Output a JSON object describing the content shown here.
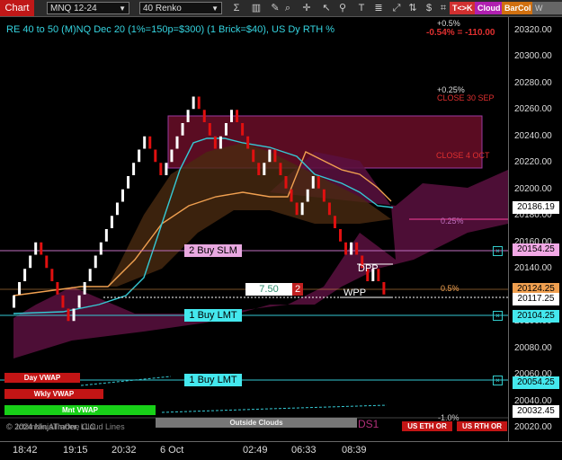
{
  "toolbar": {
    "chart_label": "Chart",
    "instrument": "MNQ 12-24",
    "bar_type": "40 Renko",
    "tck_label": "T<>K",
    "cloud_label": "Cloud",
    "barcol_label": "BarCol",
    "wvwa_label": "W VWA",
    "icons": [
      "sigma-icon",
      "chart-bars-icon",
      "draw-icon",
      "magnify-icon",
      "crosshair-icon",
      "cursor-icon",
      "pin-icon",
      "text-icon",
      "notes-icon",
      "fit-icon",
      "up-down-icon",
      "dollar-icon",
      "screenshot-icon",
      "table-icon"
    ]
  },
  "chart": {
    "title": "RE 40 to 50 (M)NQ Dec 20 (1%=150p=$300) (1 Brick=$40), US Dy RTH %",
    "pct_top": "+0.5%",
    "pct_change": "-0.54% = -110.00",
    "pct_025": "+0.25%",
    "close_30sep": "CLOSE 30 SEP",
    "close_4oct": "CLOSE 4 OCT",
    "line_025": "0.25%",
    "line_05": "0.5%",
    "line_neg1": "-1.0%",
    "dpp": "DPP",
    "wpp": "WPP",
    "ds1": "DS1",
    "outside_clouds": "Outside Clouds",
    "order_qty": "7.50",
    "order_count": "2",
    "buy_slm": "2 Buy SLM",
    "buy_lmt_1": "1 Buy LMT",
    "buy_lmt_2": "1 Buy LMT",
    "day_vwap": "Day VWAP",
    "wkly_vwap": "Wkly VWAP",
    "mnt_vwap": "Mnt VWAP",
    "copyright": "© 2024 NinjaTrader, LLC",
    "ichimoku_label": "IchimokuAllInOne Cloud Lines",
    "us_eth_or": "US ETH OR",
    "us_rth_or": "US RTH OR"
  },
  "price_axis": {
    "labels": [
      "20320.00",
      "20300.00",
      "20280.00",
      "20260.00",
      "20240.00",
      "20220.00",
      "20200.00",
      "20180.00",
      "20160.00",
      "20140.00",
      "20120.00",
      "20100.00",
      "20080.00",
      "20060.00",
      "20040.00",
      "20020.00"
    ],
    "tags": [
      {
        "value": "20186.19",
        "color": "#ffffff"
      },
      {
        "value": "20154.25",
        "color": "#f2a8e6"
      },
      {
        "value": "20124.25",
        "color": "#f0a050"
      },
      {
        "value": "20117.25",
        "color": "#ffffff"
      },
      {
        "value": "20104.25",
        "color": "#44e8ee"
      },
      {
        "value": "20054.25",
        "color": "#44e8ee"
      },
      {
        "value": "20032.45",
        "color": "#ffffff"
      }
    ]
  },
  "time_axis": [
    "18:42",
    "19:15",
    "20:32",
    "6 Oct",
    "02:49",
    "06:33",
    "08:39"
  ],
  "colors": {
    "up": "#ffffff",
    "down": "#e01010",
    "teal": "#35c9d4",
    "orange": "#f0a050",
    "magenta": "#c0307a"
  },
  "chart_data": {
    "type": "renko",
    "brick_size": 10,
    "bricks": [
      {
        "o": 20110,
        "c": 20120
      },
      {
        "o": 20120,
        "c": 20130
      },
      {
        "o": 20130,
        "c": 20140
      },
      {
        "o": 20140,
        "c": 20150
      },
      {
        "o": 20150,
        "c": 20160
      },
      {
        "o": 20160,
        "c": 20150
      },
      {
        "o": 20150,
        "c": 20140
      },
      {
        "o": 20140,
        "c": 20130
      },
      {
        "o": 20130,
        "c": 20120
      },
      {
        "o": 20120,
        "c": 20110
      },
      {
        "o": 20110,
        "c": 20100
      },
      {
        "o": 20100,
        "c": 20110
      },
      {
        "o": 20110,
        "c": 20120
      },
      {
        "o": 20120,
        "c": 20130
      },
      {
        "o": 20130,
        "c": 20140
      },
      {
        "o": 20140,
        "c": 20150
      },
      {
        "o": 20150,
        "c": 20160
      },
      {
        "o": 20160,
        "c": 20170
      },
      {
        "o": 20170,
        "c": 20180
      },
      {
        "o": 20180,
        "c": 20190
      },
      {
        "o": 20190,
        "c": 20200
      },
      {
        "o": 20200,
        "c": 20210
      },
      {
        "o": 20210,
        "c": 20220
      },
      {
        "o": 20220,
        "c": 20230
      },
      {
        "o": 20230,
        "c": 20240
      },
      {
        "o": 20240,
        "c": 20230
      },
      {
        "o": 20230,
        "c": 20220
      },
      {
        "o": 20220,
        "c": 20210
      },
      {
        "o": 20210,
        "c": 20220
      },
      {
        "o": 20220,
        "c": 20230
      },
      {
        "o": 20230,
        "c": 20240
      },
      {
        "o": 20240,
        "c": 20250
      },
      {
        "o": 20250,
        "c": 20260
      },
      {
        "o": 20260,
        "c": 20270
      },
      {
        "o": 20270,
        "c": 20260
      },
      {
        "o": 20260,
        "c": 20250
      },
      {
        "o": 20250,
        "c": 20240
      },
      {
        "o": 20240,
        "c": 20230
      },
      {
        "o": 20230,
        "c": 20240
      },
      {
        "o": 20240,
        "c": 20250
      },
      {
        "o": 20250,
        "c": 20260
      },
      {
        "o": 20260,
        "c": 20250
      },
      {
        "o": 20250,
        "c": 20240
      },
      {
        "o": 20240,
        "c": 20230
      },
      {
        "o": 20230,
        "c": 20220
      },
      {
        "o": 20220,
        "c": 20210
      },
      {
        "o": 20210,
        "c": 20220
      },
      {
        "o": 20220,
        "c": 20230
      },
      {
        "o": 20230,
        "c": 20220
      },
      {
        "o": 20220,
        "c": 20210
      },
      {
        "o": 20210,
        "c": 20200
      },
      {
        "o": 20200,
        "c": 20190
      },
      {
        "o": 20190,
        "c": 20180
      },
      {
        "o": 20180,
        "c": 20190
      },
      {
        "o": 20190,
        "c": 20200
      },
      {
        "o": 20200,
        "c": 20210
      },
      {
        "o": 20210,
        "c": 20200
      },
      {
        "o": 20200,
        "c": 20190
      },
      {
        "o": 20190,
        "c": 20180
      },
      {
        "o": 20180,
        "c": 20170
      },
      {
        "o": 20170,
        "c": 20160
      },
      {
        "o": 20160,
        "c": 20150
      },
      {
        "o": 20150,
        "c": 20160
      },
      {
        "o": 20160,
        "c": 20150
      },
      {
        "o": 20150,
        "c": 20140
      },
      {
        "o": 20140,
        "c": 20130
      },
      {
        "o": 20130,
        "c": 20140
      },
      {
        "o": 20140,
        "c": 20130
      },
      {
        "o": 20130,
        "c": 20120
      }
    ],
    "ylim": [
      20010,
      20330
    ]
  }
}
